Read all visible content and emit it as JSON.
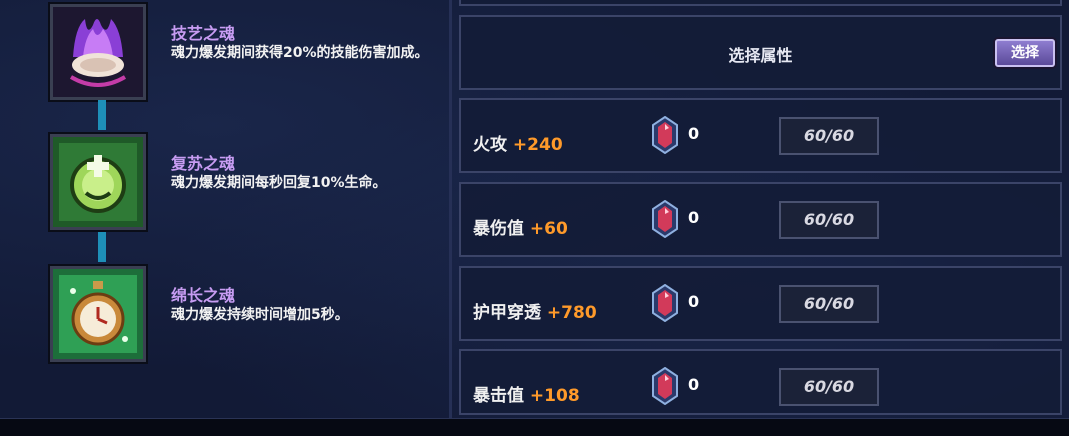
{
  "souls": [
    {
      "name": "技艺之魂",
      "desc": "魂力爆发期间获得20%的技能伤害加成。",
      "icon": "purple-flame-shell-icon"
    },
    {
      "name": "复苏之魂",
      "desc": "魂力爆发期间每秒回复10%生命。",
      "icon": "green-healing-orb-icon"
    },
    {
      "name": "绵长之魂",
      "desc": "魂力爆发持续时间增加5秒。",
      "icon": "green-stopwatch-icon"
    }
  ],
  "select_panel": {
    "title": "选择属性",
    "button": "选择"
  },
  "stats": [
    {
      "name": "火攻",
      "bonus": "+240",
      "gem_count": "0",
      "level": "60/60"
    },
    {
      "name": "暴伤值",
      "bonus": "+60",
      "gem_count": "0",
      "level": "60/60"
    },
    {
      "name": "护甲穿透",
      "bonus": "+780",
      "gem_count": "0",
      "level": "60/60"
    },
    {
      "name": "暴击值",
      "bonus": "+108",
      "gem_count": "0",
      "level": "60/60"
    }
  ],
  "colors": {
    "soul_name": "#c79cf2",
    "bonus": "#ff9a2a",
    "connector": "#1e8fb8",
    "button": "#6f5db5"
  }
}
